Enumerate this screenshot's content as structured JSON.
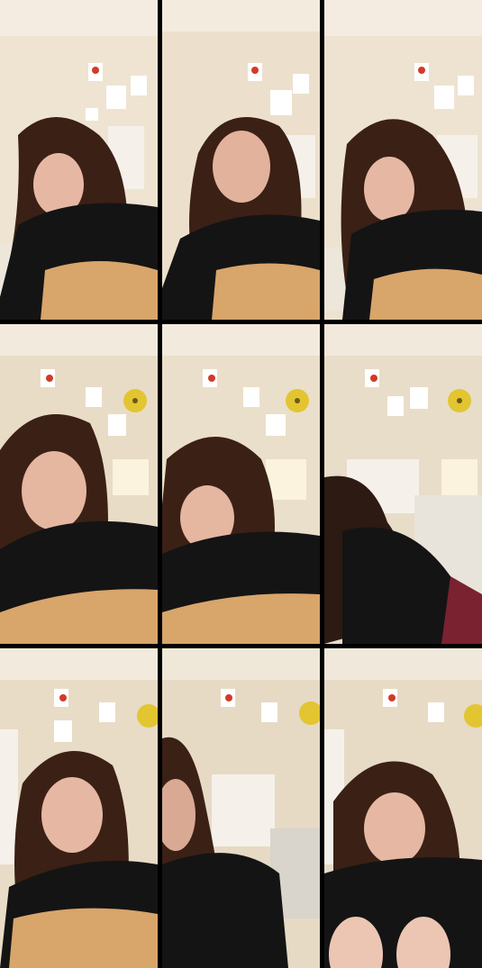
{
  "collage": {
    "rows": 3,
    "columns": 3,
    "frames": [
      {
        "pose": "looking-down-right",
        "guitar": true,
        "shade": "#efe4d2"
      },
      {
        "pose": "facing-camera",
        "guitar": true,
        "shade": "#ece0cc"
      },
      {
        "pose": "looking-down-right",
        "guitar": true,
        "shade": "#eee3d1"
      },
      {
        "pose": "facing-camera-close",
        "guitar": true,
        "shade": "#e9dcc6"
      },
      {
        "pose": "looking-down-left",
        "guitar": true,
        "shade": "#eadfca"
      },
      {
        "pose": "turned-away",
        "guitar": false,
        "shade": "#e8ddc9"
      },
      {
        "pose": "facing-camera",
        "guitar": true,
        "shade": "#e8dcc7"
      },
      {
        "pose": "blurred-motion",
        "guitar": false,
        "shade": "#e6dac5"
      },
      {
        "pose": "facing-camera-knees",
        "guitar": false,
        "shade": "#e7dbc6"
      }
    ]
  }
}
